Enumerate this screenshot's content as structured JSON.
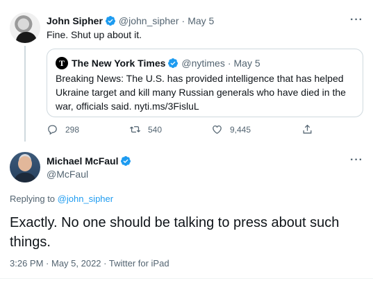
{
  "parent_tweet": {
    "name": "John Sipher",
    "handle": "@john_sipher",
    "date": "May 5",
    "text": "Fine. Shut up about it.",
    "quote": {
      "name": "The New York Times",
      "handle": "@nytimes",
      "date": "May 5",
      "logo_letter": "T",
      "text": "Breaking News: The U.S. has provided intelligence that has helped Ukraine target and kill many Russian generals who have died in the war, officials said. nyti.ms/3FisluL"
    },
    "actions": {
      "replies": "298",
      "retweets": "540",
      "likes": "9,445"
    }
  },
  "main_tweet": {
    "name": "Michael McFaul",
    "handle": "@McFaul",
    "replying_prefix": "Replying to",
    "replying_to": "@john_sipher",
    "text": "Exactly. No one should be talking to press about such things.",
    "time": "3:26 PM",
    "date": "May 5, 2022",
    "source": "Twitter for iPad",
    "separator": " · "
  },
  "more_label": "···",
  "dot": "·",
  "colors": {
    "verified": "#1d9bf0",
    "link": "#1d9bf0",
    "muted": "#536471",
    "border": "#cfd9de"
  },
  "icons": [
    "verified-badge-icon",
    "reply-icon",
    "retweet-icon",
    "like-icon",
    "share-icon",
    "more-icon"
  ]
}
